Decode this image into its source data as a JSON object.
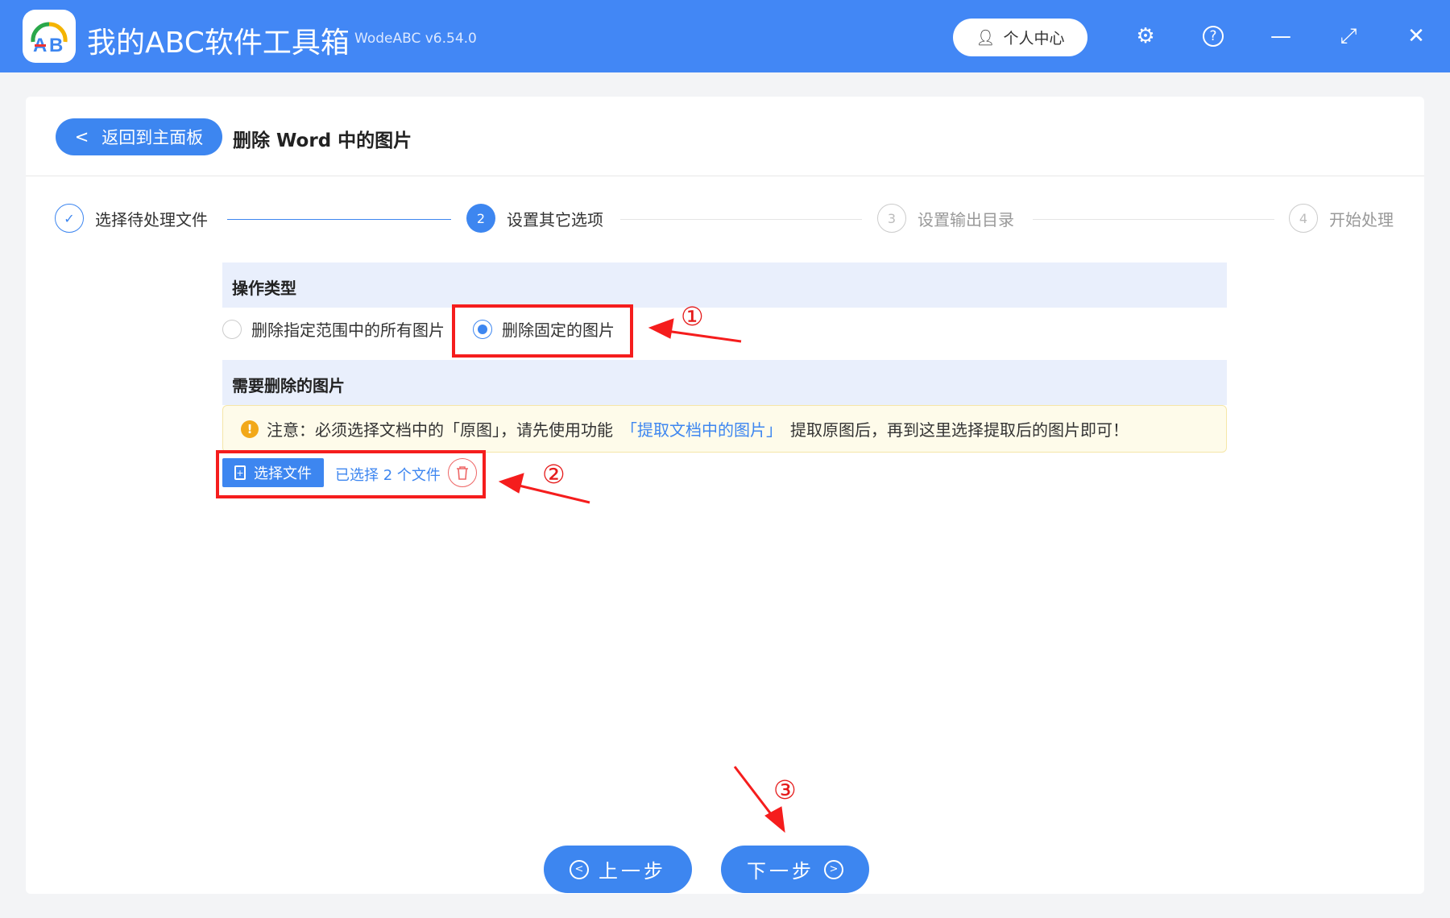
{
  "app": {
    "title": "我的ABC软件工具箱",
    "version": "WodeABC v6.54.0",
    "user_center": "个人中心"
  },
  "page": {
    "back": "返回到主面板",
    "title": "删除 Word 中的图片"
  },
  "steps": [
    {
      "num": "✓",
      "label": "选择待处理文件"
    },
    {
      "num": "2",
      "label": "设置其它选项"
    },
    {
      "num": "3",
      "label": "设置输出目录"
    },
    {
      "num": "4",
      "label": "开始处理"
    }
  ],
  "section_op": {
    "title": "操作类型",
    "options": [
      "删除指定范围中的所有图片",
      "删除固定的图片"
    ],
    "selected": 1
  },
  "section_img": {
    "title": "需要删除的图片",
    "notice_pre": "注意：必须选择文档中的「原图」，请先使用功能",
    "notice_link": "「提取文档中的图片」",
    "notice_post": "提取原图后，再到这里选择提取后的图片即可！",
    "select_btn": "选择文件",
    "selected_count": "已选择 2 个文件"
  },
  "annotations": [
    "①",
    "②",
    "③"
  ],
  "nav": {
    "prev": "上一步",
    "next": "下一步"
  },
  "colors": {
    "primary": "#3d86f0",
    "titlebar": "#4287f5",
    "annotation": "#f51d1d"
  }
}
